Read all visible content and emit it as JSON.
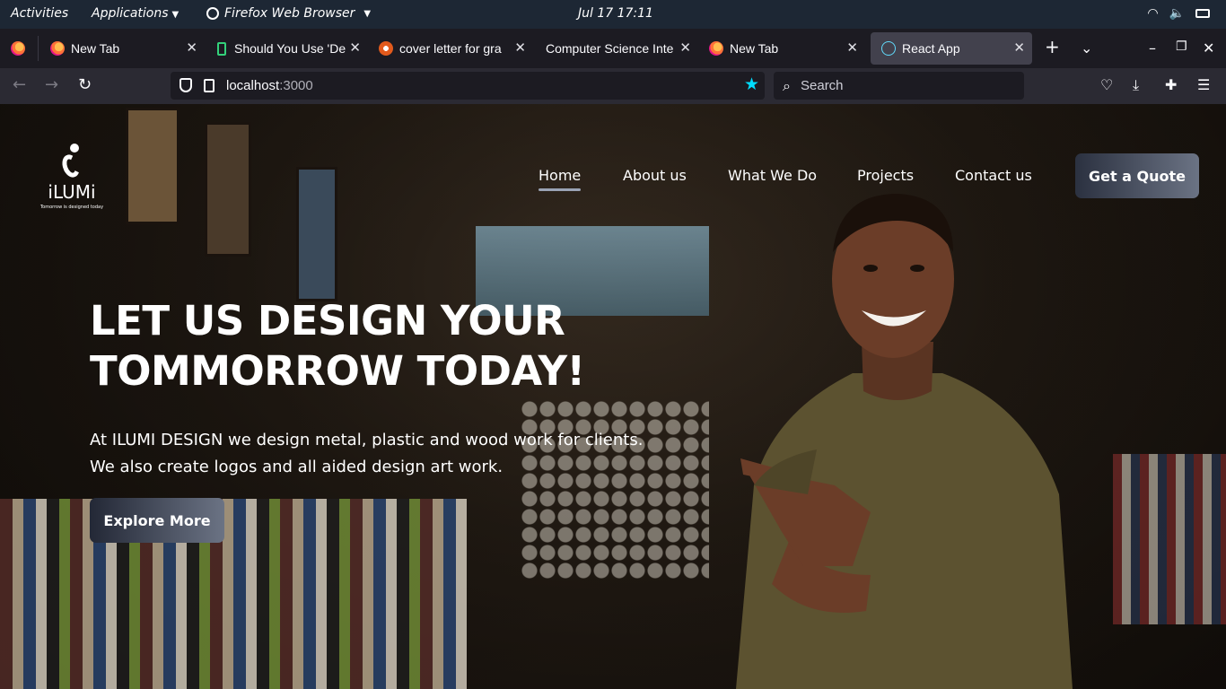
{
  "system_bar": {
    "activities": "Activities",
    "applications": "Applications",
    "app_name": "Firefox Web Browser",
    "clock": "Jul 17  17:11"
  },
  "tabs": [
    {
      "label": "New Tab",
      "icon": "firefox-icon"
    },
    {
      "label": "Should You Use 'De",
      "icon": "document-icon"
    },
    {
      "label": "cover letter for gra",
      "icon": "grammarly-icon"
    },
    {
      "label": "Computer Science Inte",
      "icon": "none"
    },
    {
      "label": "New Tab",
      "icon": "firefox-icon"
    },
    {
      "label": "React App",
      "icon": "react-icon",
      "active": true
    }
  ],
  "toolbar": {
    "url_host": "localhost",
    "url_port": ":3000",
    "search_placeholder": "Search"
  },
  "site": {
    "logo_name": "iLUMi",
    "logo_tagline": "Tomorrow is designed today",
    "nav": [
      "Home",
      "About us",
      "What We Do",
      "Projects",
      "Contact us"
    ],
    "quote_button": "Get a Quote",
    "hero_title_line1": "LET US DESIGN YOUR",
    "hero_title_line2": "TOMMORROW TODAY!",
    "hero_subtitle": "At ILUMI DESIGN we design metal, plastic and wood work for clients. We also create logos and all aided design art work.",
    "explore_button": "Explore More"
  },
  "colors": {
    "accent_star": "#00ddff",
    "button_gradient_start": "#2b3140",
    "button_gradient_end": "#6b7384"
  }
}
